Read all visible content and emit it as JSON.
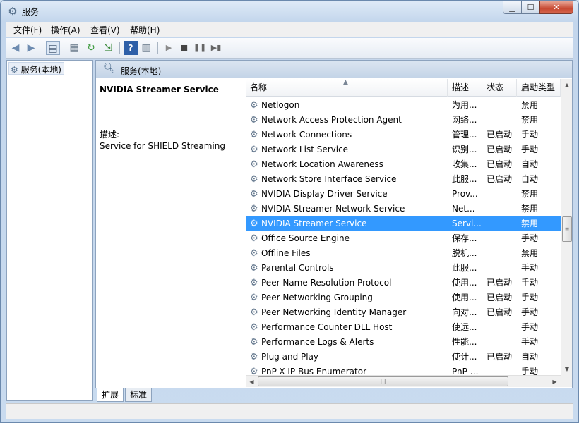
{
  "window": {
    "title": "服务"
  },
  "menu": [
    "文件(F)",
    "操作(A)",
    "查看(V)",
    "帮助(H)"
  ],
  "toolbar_icons": [
    "back-icon",
    "forward-icon",
    "console-tree-icon",
    "properties-icon",
    "refresh-icon",
    "export-icon",
    "help-icon",
    "view-icon",
    "start-icon",
    "stop-icon",
    "pause-icon",
    "restart-icon"
  ],
  "left_pane": {
    "item": "服务(本地)"
  },
  "panel": {
    "title": "服务(本地)",
    "selected_name": "NVIDIA Streamer Service",
    "desc_label": "描述:",
    "desc": "Service for SHIELD Streaming"
  },
  "columns": {
    "name": "名称",
    "desc": "描述",
    "status": "状态",
    "startup": "启动类型"
  },
  "services": [
    {
      "name": "Netlogon",
      "desc": "为用...",
      "status": "",
      "startup": "禁用"
    },
    {
      "name": "Network Access Protection Agent",
      "desc": "网络...",
      "status": "",
      "startup": "禁用"
    },
    {
      "name": "Network Connections",
      "desc": "管理...",
      "status": "已启动",
      "startup": "手动"
    },
    {
      "name": "Network List Service",
      "desc": "识别...",
      "status": "已启动",
      "startup": "手动"
    },
    {
      "name": "Network Location Awareness",
      "desc": "收集...",
      "status": "已启动",
      "startup": "自动"
    },
    {
      "name": "Network Store Interface Service",
      "desc": "此服...",
      "status": "已启动",
      "startup": "自动"
    },
    {
      "name": "NVIDIA Display Driver Service",
      "desc": "Prov...",
      "status": "",
      "startup": "禁用"
    },
    {
      "name": "NVIDIA Streamer Network Service",
      "desc": "Net...",
      "status": "",
      "startup": "禁用"
    },
    {
      "name": "NVIDIA Streamer Service",
      "desc": "Servi...",
      "status": "",
      "startup": "禁用",
      "selected": true
    },
    {
      "name": "Office Source Engine",
      "desc": "保存...",
      "status": "",
      "startup": "手动"
    },
    {
      "name": "Offline Files",
      "desc": "脱机...",
      "status": "",
      "startup": "禁用"
    },
    {
      "name": "Parental Controls",
      "desc": "此服...",
      "status": "",
      "startup": "手动"
    },
    {
      "name": "Peer Name Resolution Protocol",
      "desc": "使用...",
      "status": "已启动",
      "startup": "手动"
    },
    {
      "name": "Peer Networking Grouping",
      "desc": "使用...",
      "status": "已启动",
      "startup": "手动"
    },
    {
      "name": "Peer Networking Identity Manager",
      "desc": "向对...",
      "status": "已启动",
      "startup": "手动"
    },
    {
      "name": "Performance Counter DLL Host",
      "desc": "使远...",
      "status": "",
      "startup": "手动"
    },
    {
      "name": "Performance Logs & Alerts",
      "desc": "性能...",
      "status": "",
      "startup": "手动"
    },
    {
      "name": "Plug and Play",
      "desc": "使计...",
      "status": "已启动",
      "startup": "自动"
    },
    {
      "name": "PnP-X IP Bus Enumerator",
      "desc": "PnP-...",
      "status": "",
      "startup": "手动"
    }
  ],
  "tabs": [
    "扩展",
    "标准"
  ]
}
